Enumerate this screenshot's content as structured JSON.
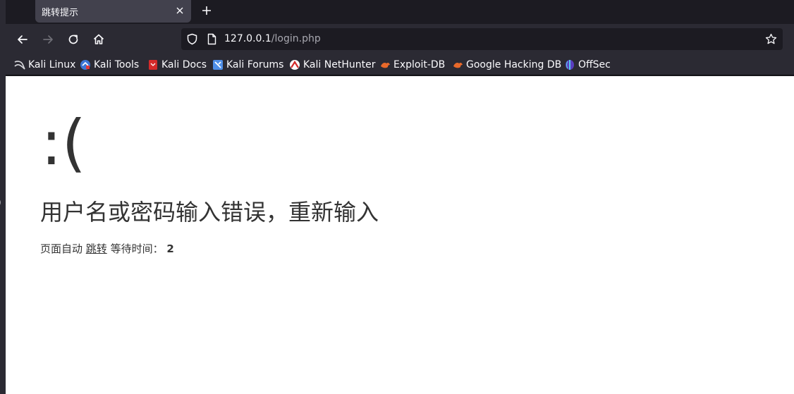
{
  "tab": {
    "title": "跳转提示"
  },
  "address_bar": {
    "host": "127.0.0.1",
    "path": "/login.php"
  },
  "bookmarks": [
    {
      "label": "Kali Linux",
      "icon": "kali-dragon-icon"
    },
    {
      "label": "Kali Tools",
      "icon": "kali-tools-icon"
    },
    {
      "label": "Kali Docs",
      "icon": "kali-docs-icon"
    },
    {
      "label": "Kali Forums",
      "icon": "kali-forums-icon"
    },
    {
      "label": "Kali NetHunter",
      "icon": "nethunter-icon"
    },
    {
      "label": "Exploit-DB",
      "icon": "exploit-db-icon"
    },
    {
      "label": "Google Hacking DB",
      "icon": "ghdb-icon"
    },
    {
      "label": "OffSec",
      "icon": "offsec-icon"
    }
  ],
  "page": {
    "face": ":(",
    "message": "用户名或密码输入错误，重新输入",
    "redirect_prefix": "页面自动",
    "redirect_link": "跳转",
    "wait_label": "等待时间：",
    "wait_seconds": "2"
  },
  "edge_glyph": ")",
  "colors": {
    "chrome_dark": "#1c1b22",
    "chrome_toolbar": "#2b2a33",
    "tab_active": "#42414d",
    "page_text": "#333333"
  }
}
